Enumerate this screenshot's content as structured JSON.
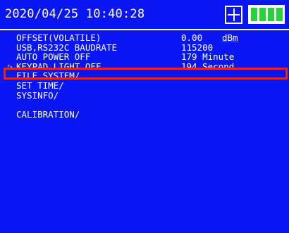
{
  "header": {
    "datetime": "2020/04/25 10:40:28",
    "icons": [
      "plus-box-icon",
      "battery-full-icon"
    ],
    "battery_color": "#28d13d"
  },
  "menu": {
    "cursor_glyph": "▷",
    "items": [
      {
        "label": "OFFSET(VOLATILE)",
        "value": "0.00",
        "unit": "dBm"
      },
      {
        "label": "USB,RS232C BAUDRATE",
        "value": "115200",
        "unit": ""
      },
      {
        "label": "AUTO POWER OFF",
        "value": "179 Minute",
        "unit": ""
      },
      {
        "label": "KEYPAD LIGHT OFF",
        "value": "194 Second",
        "unit": ""
      },
      {
        "label": "FILE SYSTEM/",
        "value": "",
        "unit": ""
      },
      {
        "label": "SET TIME/",
        "value": "",
        "unit": ""
      },
      {
        "label": "SYSINFO/",
        "value": "",
        "unit": ""
      },
      {
        "label": "",
        "value": "",
        "unit": ""
      },
      {
        "label": "CALIBRATION/",
        "value": "",
        "unit": ""
      }
    ],
    "selected_index": 3
  },
  "colors": {
    "background": "#0a16f2",
    "text": "#ffffff",
    "selection": "#e8261b"
  }
}
